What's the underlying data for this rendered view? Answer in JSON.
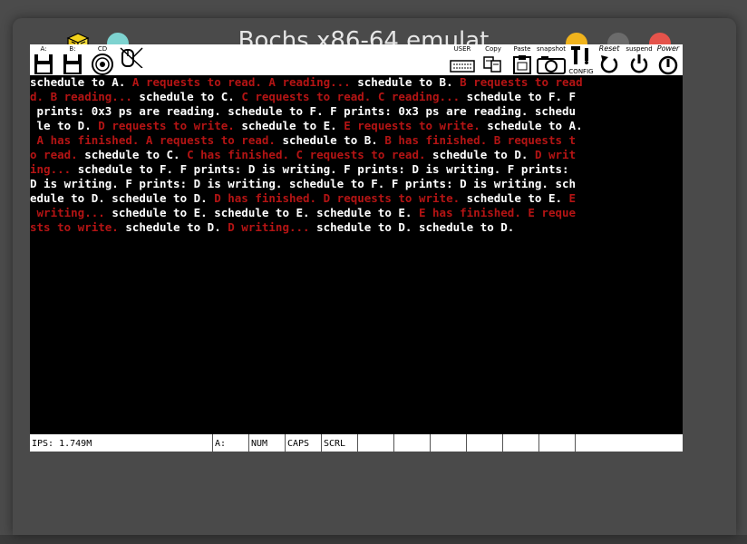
{
  "window": {
    "title": "Bochs x86-64 emulat…"
  },
  "toolbar": {
    "items": [
      {
        "name": "floppy-a",
        "label": "A:"
      },
      {
        "name": "floppy-b",
        "label": "B:"
      },
      {
        "name": "cdrom",
        "label": "CD"
      },
      {
        "name": "mouse",
        "label": ""
      },
      {
        "name": "user",
        "label": "USER"
      },
      {
        "name": "copy",
        "label": "Copy"
      },
      {
        "name": "paste",
        "label": "Paste"
      },
      {
        "name": "snapshot",
        "label": "snapshot"
      },
      {
        "name": "config",
        "label": "CONFIG"
      },
      {
        "name": "reset",
        "label": "Reset"
      },
      {
        "name": "suspend",
        "label": "suspend"
      },
      {
        "name": "power",
        "label": "Power"
      }
    ]
  },
  "console": {
    "lines": [
      [
        {
          "c": "w",
          "t": "schedule to A. "
        },
        {
          "c": "r",
          "t": "A requests to read. A reading... "
        },
        {
          "c": "w",
          "t": "schedule to B. "
        },
        {
          "c": "r",
          "t": "B requests to read"
        }
      ],
      [
        {
          "c": "r",
          "t": "d. B reading... "
        },
        {
          "c": "w",
          "t": "schedule to C. "
        },
        {
          "c": "r",
          "t": "C requests to read. C reading... "
        },
        {
          "c": "w",
          "t": "schedule to F. F"
        }
      ],
      [
        {
          "c": "w",
          "t": " prints: 0x3 ps are reading. schedule to F. F prints: 0x3 ps are reading. schedu"
        }
      ],
      [
        {
          "c": "w",
          "t": " le to D. "
        },
        {
          "c": "r",
          "t": "D requests to write. "
        },
        {
          "c": "w",
          "t": "schedule to E. "
        },
        {
          "c": "r",
          "t": "E requests to write. "
        },
        {
          "c": "w",
          "t": "schedule to A."
        }
      ],
      [
        {
          "c": "r",
          "t": " A has finished. A requests to read. "
        },
        {
          "c": "w",
          "t": "schedule to B. "
        },
        {
          "c": "r",
          "t": "B has finished. B requests t"
        }
      ],
      [
        {
          "c": "r",
          "t": "o read. "
        },
        {
          "c": "w",
          "t": "schedule to C. "
        },
        {
          "c": "r",
          "t": "C has finished. C requests to read. "
        },
        {
          "c": "w",
          "t": "schedule to D. "
        },
        {
          "c": "r",
          "t": "D writ"
        }
      ],
      [
        {
          "c": "r",
          "t": "ing... "
        },
        {
          "c": "w",
          "t": "schedule to F. F prints: D is writing. F prints: D is writing. F prints:"
        }
      ],
      [
        {
          "c": "w",
          "t": "D is writing. F prints: D is writing. schedule to F. F prints: D is writing. sch"
        }
      ],
      [
        {
          "c": "w",
          "t": "edule to D. schedule to D. "
        },
        {
          "c": "r",
          "t": "D has finished. D requests to write. "
        },
        {
          "c": "w",
          "t": "schedule to E. "
        },
        {
          "c": "r",
          "t": "E"
        }
      ],
      [
        {
          "c": "r",
          "t": " writing... "
        },
        {
          "c": "w",
          "t": "schedule to E. schedule to E. schedule to E. "
        },
        {
          "c": "r",
          "t": "E has finished. E reque"
        }
      ],
      [
        {
          "c": "r",
          "t": "sts to write. "
        },
        {
          "c": "w",
          "t": "schedule to D. "
        },
        {
          "c": "r",
          "t": "D writing... "
        },
        {
          "c": "w",
          "t": "schedule to D. schedule to D."
        }
      ]
    ]
  },
  "statusbar": {
    "ips": "IPS: 1.749M",
    "drive": "A:",
    "num": "NUM",
    "caps": "CAPS",
    "scrl": "SCRL"
  },
  "colors": {
    "console_text": "#ffffff",
    "console_highlight": "#b41414",
    "console_bg": "#000000",
    "minimize": "#f0b31c",
    "close": "#e5534b",
    "pin": "#7ed3d0"
  }
}
